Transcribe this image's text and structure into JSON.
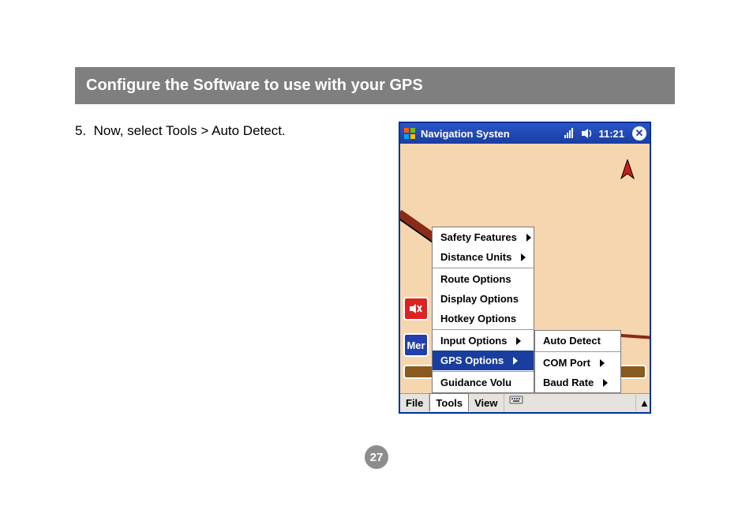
{
  "header": {
    "title": "Configure the Software to use with your GPS"
  },
  "step": {
    "number": "5.",
    "text": "Now, select Tools > Auto Detect."
  },
  "device": {
    "title": "Navigation Systen",
    "clock": "11:21",
    "side_buttons": {
      "mute_icon": "speaker-mute-icon",
      "menu_label": "Mer"
    },
    "menubar": {
      "items": [
        "File",
        "Tools",
        "View"
      ],
      "open_index": 1
    },
    "tools_menu": {
      "groups": [
        [
          {
            "label": "Safety Features",
            "submenu": true
          },
          {
            "label": "Distance Units",
            "submenu": true
          }
        ],
        [
          {
            "label": "Route Options",
            "submenu": false
          },
          {
            "label": "Display Options",
            "submenu": false
          },
          {
            "label": "Hotkey Options",
            "submenu": false
          }
        ],
        [
          {
            "label": "Input Options",
            "submenu": true
          },
          {
            "label": "GPS Options",
            "submenu": true,
            "selected": true
          }
        ],
        [
          {
            "label": "Guidance Volu",
            "submenu": false
          }
        ]
      ]
    },
    "gps_submenu": [
      {
        "label": "Auto Detect",
        "submenu": false
      },
      {
        "label": "COM Port",
        "submenu": true
      },
      {
        "label": "Baud Rate",
        "submenu": true
      }
    ]
  },
  "page_number": "27"
}
